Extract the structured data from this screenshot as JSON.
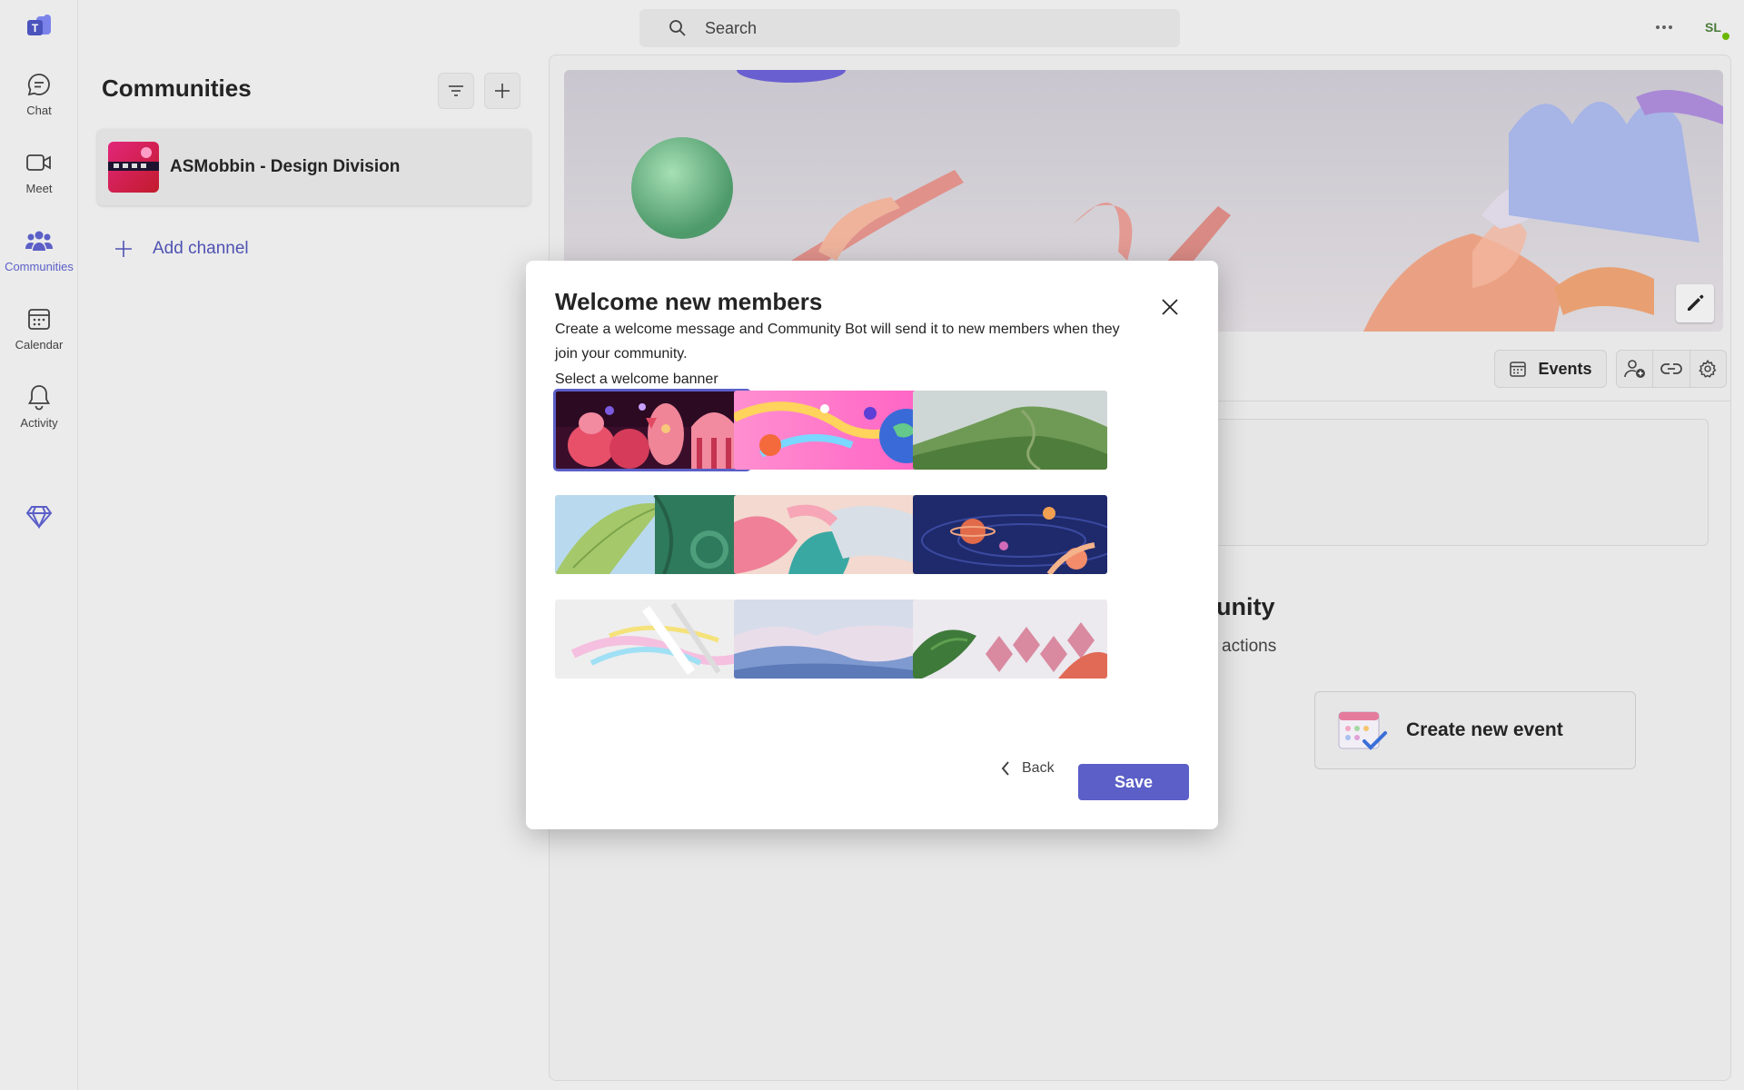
{
  "rail": {
    "items": [
      {
        "label": "Chat",
        "icon": "chat-icon"
      },
      {
        "label": "Meet",
        "icon": "video-icon"
      },
      {
        "label": "Communities",
        "icon": "people-icon"
      },
      {
        "label": "Calendar",
        "icon": "calendar-icon"
      },
      {
        "label": "Activity",
        "icon": "bell-icon"
      }
    ],
    "active": "Communities",
    "accent": "#5b5fc7"
  },
  "topbar": {
    "search_placeholder": "Search",
    "avatar_initials": "SL",
    "status_color": "#6bb700"
  },
  "communities": {
    "title": "Communities",
    "items": [
      {
        "name": "ASMobbin - Design Division"
      }
    ],
    "add_channel_label": "Add channel"
  },
  "main": {
    "events_label": "Events",
    "heading_partial": "unity",
    "sub_partial": "actions",
    "create_event_label": "Create new event"
  },
  "dialog": {
    "title": "Welcome new members",
    "description": "Create a welcome message and Community Bot will send it to new members when they join your community.",
    "banner_label": "Select a welcome banner",
    "selected_banner": 1,
    "back_label": "Back",
    "save_label": "Save",
    "save_color": "#5b5fc7"
  }
}
